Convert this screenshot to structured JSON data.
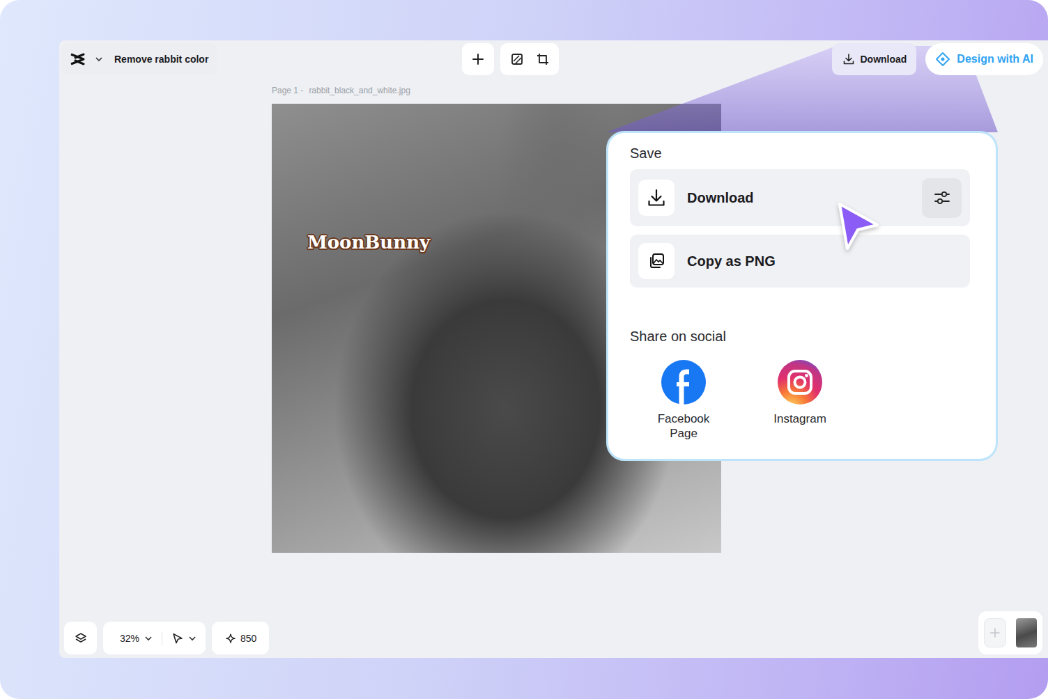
{
  "document": {
    "title": "Remove rabbit color"
  },
  "header": {
    "download": "Download",
    "design_ai": "Design with AI"
  },
  "canvas": {
    "page_label": "Page 1 -",
    "file_name": "rabbit_black_and_white.jpg",
    "text_layer": "MoonBunny"
  },
  "save_menu": {
    "heading": "Save",
    "items": [
      {
        "label": "Download",
        "kind": "download"
      },
      {
        "label": "Copy as PNG",
        "kind": "copy"
      }
    ],
    "social_heading": "Share on social",
    "social": [
      {
        "label": "Facebook Page",
        "kind": "facebook"
      },
      {
        "label": "Instagram",
        "kind": "instagram"
      }
    ]
  },
  "footer": {
    "zoom": "32%",
    "credits": "850"
  }
}
